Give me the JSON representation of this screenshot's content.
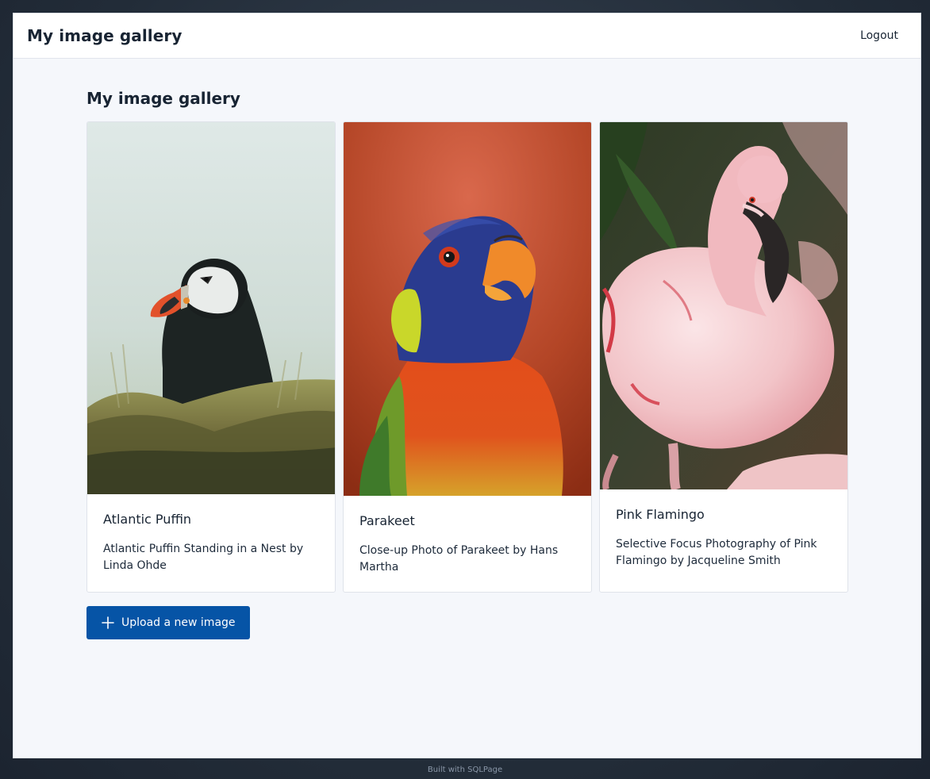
{
  "header": {
    "brand": "My image gallery",
    "logout_label": "Logout"
  },
  "main": {
    "title": "My image gallery",
    "cards": [
      {
        "title": "Atlantic Puffin",
        "description": "Atlantic Puffin Standing in a Nest by Linda Ohde"
      },
      {
        "title": "Parakeet",
        "description": "Close-up Photo of Parakeet by Hans Martha"
      },
      {
        "title": "Pink Flamingo",
        "description": "Selective Focus Photography of Pink Flamingo by Jacqueline Smith"
      }
    ],
    "upload_button": {
      "icon": "plus-icon",
      "label": "Upload a new image"
    }
  },
  "footer": {
    "text": "Built with SQLPage"
  },
  "colors": {
    "primary": "#0654a6",
    "page_background": "#f5f7fb",
    "text": "#182433"
  }
}
